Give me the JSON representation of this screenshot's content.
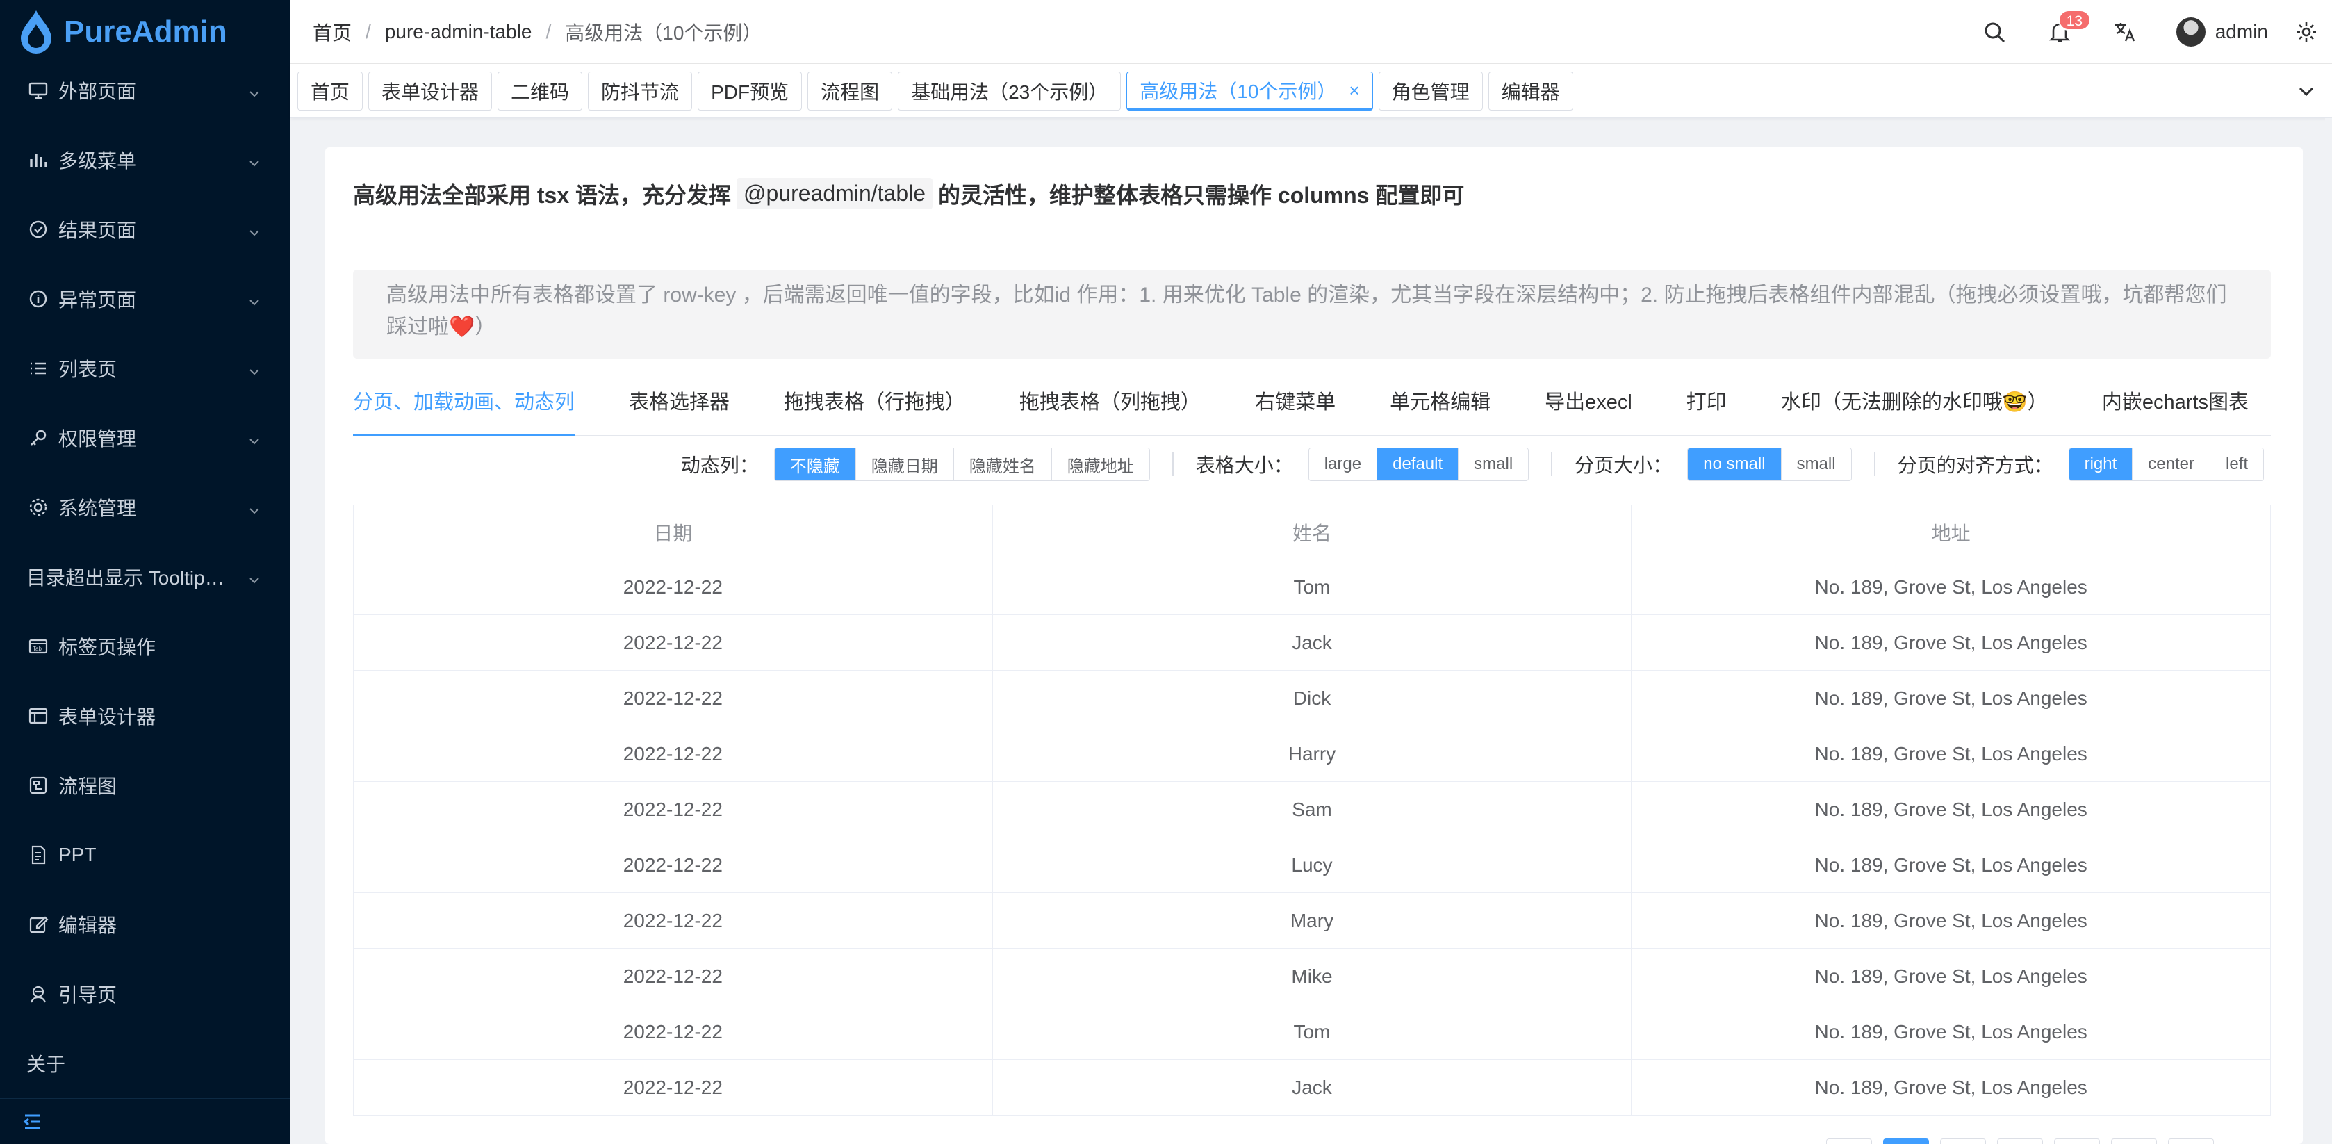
{
  "app": {
    "name": "PureAdmin",
    "brand_color": "#409eff",
    "sidebar_bg": "#001529"
  },
  "sidebar": {
    "items": [
      {
        "label": "外部页面",
        "icon": "monitor-icon",
        "has_children": true
      },
      {
        "label": "多级菜单",
        "icon": "bar-chart-icon",
        "has_children": true
      },
      {
        "label": "结果页面",
        "icon": "check-circle-icon",
        "has_children": true
      },
      {
        "label": "异常页面",
        "icon": "info-circle-icon",
        "has_children": true
      },
      {
        "label": "列表页",
        "icon": "list-icon",
        "has_children": true
      },
      {
        "label": "权限管理",
        "icon": "key-icon",
        "has_children": true
      },
      {
        "label": "系统管理",
        "icon": "gear-icon",
        "has_children": true
      },
      {
        "label": "目录超出显示 Tooltip…",
        "icon": "",
        "has_children": true
      },
      {
        "label": "标签页操作",
        "icon": "tab-icon",
        "has_children": false
      },
      {
        "label": "表单设计器",
        "icon": "form-icon",
        "has_children": false
      },
      {
        "label": "流程图",
        "icon": "flow-icon",
        "has_children": false
      },
      {
        "label": "PPT",
        "icon": "ppt-icon",
        "has_children": false
      },
      {
        "label": "编辑器",
        "icon": "edit-icon",
        "has_children": false
      },
      {
        "label": "引导页",
        "icon": "guide-icon",
        "has_children": false
      },
      {
        "label": "关于",
        "icon": "",
        "has_children": false
      }
    ],
    "collapse_icon": "menu-fold-icon"
  },
  "header": {
    "breadcrumb": [
      "首页",
      "pure-admin-table",
      "高级用法（10个示例）"
    ],
    "notification_count": "13",
    "username": "admin"
  },
  "tabs": {
    "items": [
      {
        "label": "首页",
        "active": false
      },
      {
        "label": "表单设计器",
        "active": false
      },
      {
        "label": "二维码",
        "active": false
      },
      {
        "label": "防抖节流",
        "active": false
      },
      {
        "label": "PDF预览",
        "active": false
      },
      {
        "label": "流程图",
        "active": false
      },
      {
        "label": "基础用法（23个示例）",
        "active": false
      },
      {
        "label": "高级用法（10个示例）",
        "active": true
      },
      {
        "label": "角色管理",
        "active": false
      },
      {
        "label": "编辑器",
        "active": false
      }
    ]
  },
  "main": {
    "title_prefix": "高级用法全部采用 tsx 语法，充分发挥",
    "title_code": "@pureadmin/table",
    "title_suffix": "的灵活性，维护整体表格只需操作 columns 配置即可",
    "notice": "高级用法中所有表格都设置了 row-key ，后端需返回唯一值的字段，比如id 作用：1. 用来优化 Table 的渲染，尤其当字段在深层结构中；2. 防止拖拽后表格组件内部混乱（拖拽必须设置哦，坑都帮您们踩过啦",
    "notice_emoji": "❤️",
    "notice_end": "）",
    "sub_tabs": [
      {
        "label": "分页、加载动画、动态列",
        "active": true
      },
      {
        "label": "表格选择器",
        "active": false
      },
      {
        "label": "拖拽表格（行拖拽）",
        "active": false
      },
      {
        "label": "拖拽表格（列拖拽）",
        "active": false
      },
      {
        "label": "右键菜单",
        "active": false
      },
      {
        "label": "单元格编辑",
        "active": false
      },
      {
        "label": "导出execl",
        "active": false
      },
      {
        "label": "打印",
        "active": false
      },
      {
        "label": "水印（无法删除的水印哦🤓）",
        "active": false
      },
      {
        "label": "内嵌echarts图表",
        "active": false
      }
    ],
    "controls": {
      "dynamic_columns": {
        "label": "动态列：",
        "options": [
          "不隐藏",
          "隐藏日期",
          "隐藏姓名",
          "隐藏地址"
        ],
        "selected": 0
      },
      "table_size": {
        "label": "表格大小：",
        "options": [
          "large",
          "default",
          "small"
        ],
        "selected": 1
      },
      "pager_size": {
        "label": "分页大小：",
        "options": [
          "no small",
          "small"
        ],
        "selected": 0
      },
      "pager_align": {
        "label": "分页的对齐方式：",
        "options": [
          "right",
          "center",
          "left"
        ],
        "selected": 0
      }
    },
    "table": {
      "columns": [
        "日期",
        "姓名",
        "地址"
      ],
      "rows": [
        [
          "2022-12-22",
          "Tom",
          "No. 189, Grove St, Los Angeles"
        ],
        [
          "2022-12-22",
          "Jack",
          "No. 189, Grove St, Los Angeles"
        ],
        [
          "2022-12-22",
          "Dick",
          "No. 189, Grove St, Los Angeles"
        ],
        [
          "2022-12-22",
          "Harry",
          "No. 189, Grove St, Los Angeles"
        ],
        [
          "2022-12-22",
          "Sam",
          "No. 189, Grove St, Los Angeles"
        ],
        [
          "2022-12-22",
          "Lucy",
          "No. 189, Grove St, Los Angeles"
        ],
        [
          "2022-12-22",
          "Mary",
          "No. 189, Grove St, Los Angeles"
        ],
        [
          "2022-12-22",
          "Mike",
          "No. 189, Grove St, Los Angeles"
        ],
        [
          "2022-12-22",
          "Tom",
          "No. 189, Grove St, Los Angeles"
        ],
        [
          "2022-12-22",
          "Jack",
          "No. 189, Grove St, Los Angeles"
        ]
      ]
    }
  }
}
